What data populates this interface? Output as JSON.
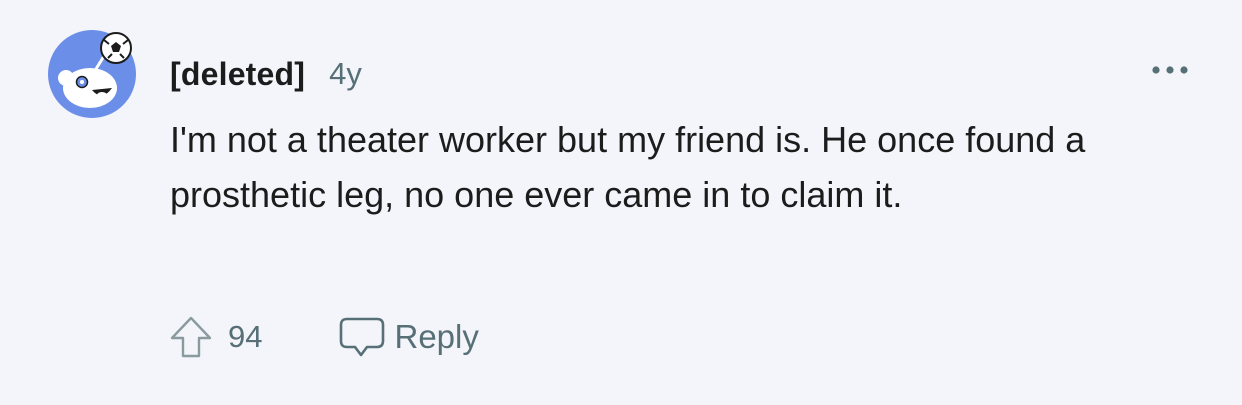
{
  "comment": {
    "author": "[deleted]",
    "age": "4y",
    "text": "I'm not a theater worker but my friend is. He once found a prosthetic leg, no one ever came in to claim it.",
    "score": "94",
    "reply_label": "Reply"
  },
  "icons": {
    "avatar": "snoo-avatar-icon",
    "more": "more-options-icon",
    "upvote": "upvote-arrow-icon",
    "reply": "speech-bubble-icon"
  },
  "colors": {
    "background": "#f3f5fa",
    "avatar_bg": "#6b8ee8",
    "text_primary": "#1c1c1c",
    "text_secondary": "#576f76"
  }
}
